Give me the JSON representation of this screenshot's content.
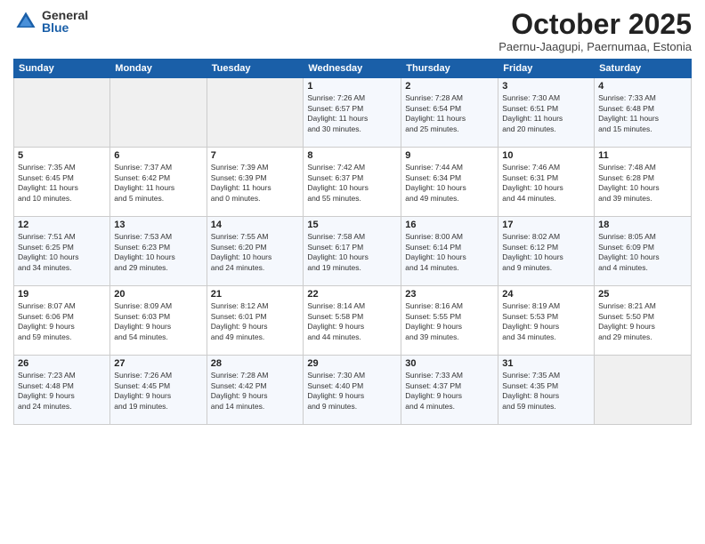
{
  "logo": {
    "general": "General",
    "blue": "Blue"
  },
  "title": "October 2025",
  "location": "Paernu-Jaagupi, Paernumaa, Estonia",
  "days_of_week": [
    "Sunday",
    "Monday",
    "Tuesday",
    "Wednesday",
    "Thursday",
    "Friday",
    "Saturday"
  ],
  "weeks": [
    [
      {
        "day": "",
        "info": ""
      },
      {
        "day": "",
        "info": ""
      },
      {
        "day": "",
        "info": ""
      },
      {
        "day": "1",
        "info": "Sunrise: 7:26 AM\nSunset: 6:57 PM\nDaylight: 11 hours\nand 30 minutes."
      },
      {
        "day": "2",
        "info": "Sunrise: 7:28 AM\nSunset: 6:54 PM\nDaylight: 11 hours\nand 25 minutes."
      },
      {
        "day": "3",
        "info": "Sunrise: 7:30 AM\nSunset: 6:51 PM\nDaylight: 11 hours\nand 20 minutes."
      },
      {
        "day": "4",
        "info": "Sunrise: 7:33 AM\nSunset: 6:48 PM\nDaylight: 11 hours\nand 15 minutes."
      }
    ],
    [
      {
        "day": "5",
        "info": "Sunrise: 7:35 AM\nSunset: 6:45 PM\nDaylight: 11 hours\nand 10 minutes."
      },
      {
        "day": "6",
        "info": "Sunrise: 7:37 AM\nSunset: 6:42 PM\nDaylight: 11 hours\nand 5 minutes."
      },
      {
        "day": "7",
        "info": "Sunrise: 7:39 AM\nSunset: 6:39 PM\nDaylight: 11 hours\nand 0 minutes."
      },
      {
        "day": "8",
        "info": "Sunrise: 7:42 AM\nSunset: 6:37 PM\nDaylight: 10 hours\nand 55 minutes."
      },
      {
        "day": "9",
        "info": "Sunrise: 7:44 AM\nSunset: 6:34 PM\nDaylight: 10 hours\nand 49 minutes."
      },
      {
        "day": "10",
        "info": "Sunrise: 7:46 AM\nSunset: 6:31 PM\nDaylight: 10 hours\nand 44 minutes."
      },
      {
        "day": "11",
        "info": "Sunrise: 7:48 AM\nSunset: 6:28 PM\nDaylight: 10 hours\nand 39 minutes."
      }
    ],
    [
      {
        "day": "12",
        "info": "Sunrise: 7:51 AM\nSunset: 6:25 PM\nDaylight: 10 hours\nand 34 minutes."
      },
      {
        "day": "13",
        "info": "Sunrise: 7:53 AM\nSunset: 6:23 PM\nDaylight: 10 hours\nand 29 minutes."
      },
      {
        "day": "14",
        "info": "Sunrise: 7:55 AM\nSunset: 6:20 PM\nDaylight: 10 hours\nand 24 minutes."
      },
      {
        "day": "15",
        "info": "Sunrise: 7:58 AM\nSunset: 6:17 PM\nDaylight: 10 hours\nand 19 minutes."
      },
      {
        "day": "16",
        "info": "Sunrise: 8:00 AM\nSunset: 6:14 PM\nDaylight: 10 hours\nand 14 minutes."
      },
      {
        "day": "17",
        "info": "Sunrise: 8:02 AM\nSunset: 6:12 PM\nDaylight: 10 hours\nand 9 minutes."
      },
      {
        "day": "18",
        "info": "Sunrise: 8:05 AM\nSunset: 6:09 PM\nDaylight: 10 hours\nand 4 minutes."
      }
    ],
    [
      {
        "day": "19",
        "info": "Sunrise: 8:07 AM\nSunset: 6:06 PM\nDaylight: 9 hours\nand 59 minutes."
      },
      {
        "day": "20",
        "info": "Sunrise: 8:09 AM\nSunset: 6:03 PM\nDaylight: 9 hours\nand 54 minutes."
      },
      {
        "day": "21",
        "info": "Sunrise: 8:12 AM\nSunset: 6:01 PM\nDaylight: 9 hours\nand 49 minutes."
      },
      {
        "day": "22",
        "info": "Sunrise: 8:14 AM\nSunset: 5:58 PM\nDaylight: 9 hours\nand 44 minutes."
      },
      {
        "day": "23",
        "info": "Sunrise: 8:16 AM\nSunset: 5:55 PM\nDaylight: 9 hours\nand 39 minutes."
      },
      {
        "day": "24",
        "info": "Sunrise: 8:19 AM\nSunset: 5:53 PM\nDaylight: 9 hours\nand 34 minutes."
      },
      {
        "day": "25",
        "info": "Sunrise: 8:21 AM\nSunset: 5:50 PM\nDaylight: 9 hours\nand 29 minutes."
      }
    ],
    [
      {
        "day": "26",
        "info": "Sunrise: 7:23 AM\nSunset: 4:48 PM\nDaylight: 9 hours\nand 24 minutes."
      },
      {
        "day": "27",
        "info": "Sunrise: 7:26 AM\nSunset: 4:45 PM\nDaylight: 9 hours\nand 19 minutes."
      },
      {
        "day": "28",
        "info": "Sunrise: 7:28 AM\nSunset: 4:42 PM\nDaylight: 9 hours\nand 14 minutes."
      },
      {
        "day": "29",
        "info": "Sunrise: 7:30 AM\nSunset: 4:40 PM\nDaylight: 9 hours\nand 9 minutes."
      },
      {
        "day": "30",
        "info": "Sunrise: 7:33 AM\nSunset: 4:37 PM\nDaylight: 9 hours\nand 4 minutes."
      },
      {
        "day": "31",
        "info": "Sunrise: 7:35 AM\nSunset: 4:35 PM\nDaylight: 8 hours\nand 59 minutes."
      },
      {
        "day": "",
        "info": ""
      }
    ]
  ]
}
